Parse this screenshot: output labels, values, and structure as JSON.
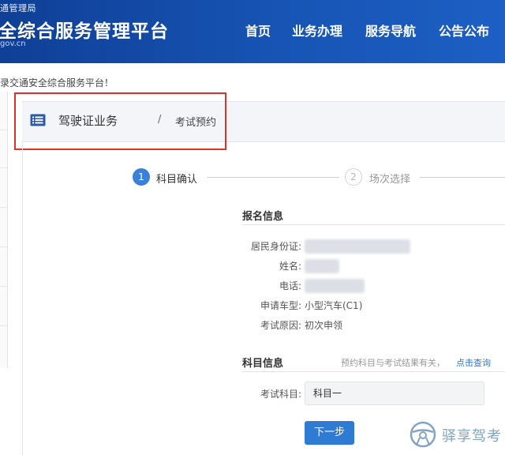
{
  "header": {
    "org": "通管理局",
    "site_title": "全综合服务管理平台",
    "domain": "gov.cn",
    "nav": [
      {
        "label": "首页"
      },
      {
        "label": "业务办理"
      },
      {
        "label": "服务导航"
      },
      {
        "label": "公告公布"
      }
    ]
  },
  "welcome": "录交通安全综合服务平台！",
  "breadcrumb": {
    "icon": "list-icon",
    "main": "驾驶证业务",
    "sep": "/",
    "sub": "考试预约"
  },
  "steps": [
    {
      "number": "1",
      "label": "科目确认",
      "active": true
    },
    {
      "number": "2",
      "label": "场次选择",
      "active": false
    }
  ],
  "registration": {
    "title": "报名信息",
    "fields": [
      {
        "label": "居民身份证:",
        "value": "",
        "redacted": true
      },
      {
        "label": "姓名:",
        "value": "",
        "redacted": true
      },
      {
        "label": "电话:",
        "value": "",
        "redacted": true
      },
      {
        "label": "申请车型:",
        "value": "小型汽车(C1)",
        "redacted": false
      },
      {
        "label": "考试原因:",
        "value": "初次申领",
        "redacted": false
      }
    ]
  },
  "subject": {
    "title": "科目信息",
    "hint": "预约科目与考试结果有关，",
    "hint_link": "点击查询",
    "label": "考试科目:",
    "selected": "科目一"
  },
  "next_button": "下一步",
  "watermark": {
    "icon": "steering-wheel-icon",
    "text": "驿享驾考"
  },
  "colors": {
    "header_bg": "#1754b4",
    "accent": "#2f7ad3",
    "highlight_box": "#d9332e"
  }
}
